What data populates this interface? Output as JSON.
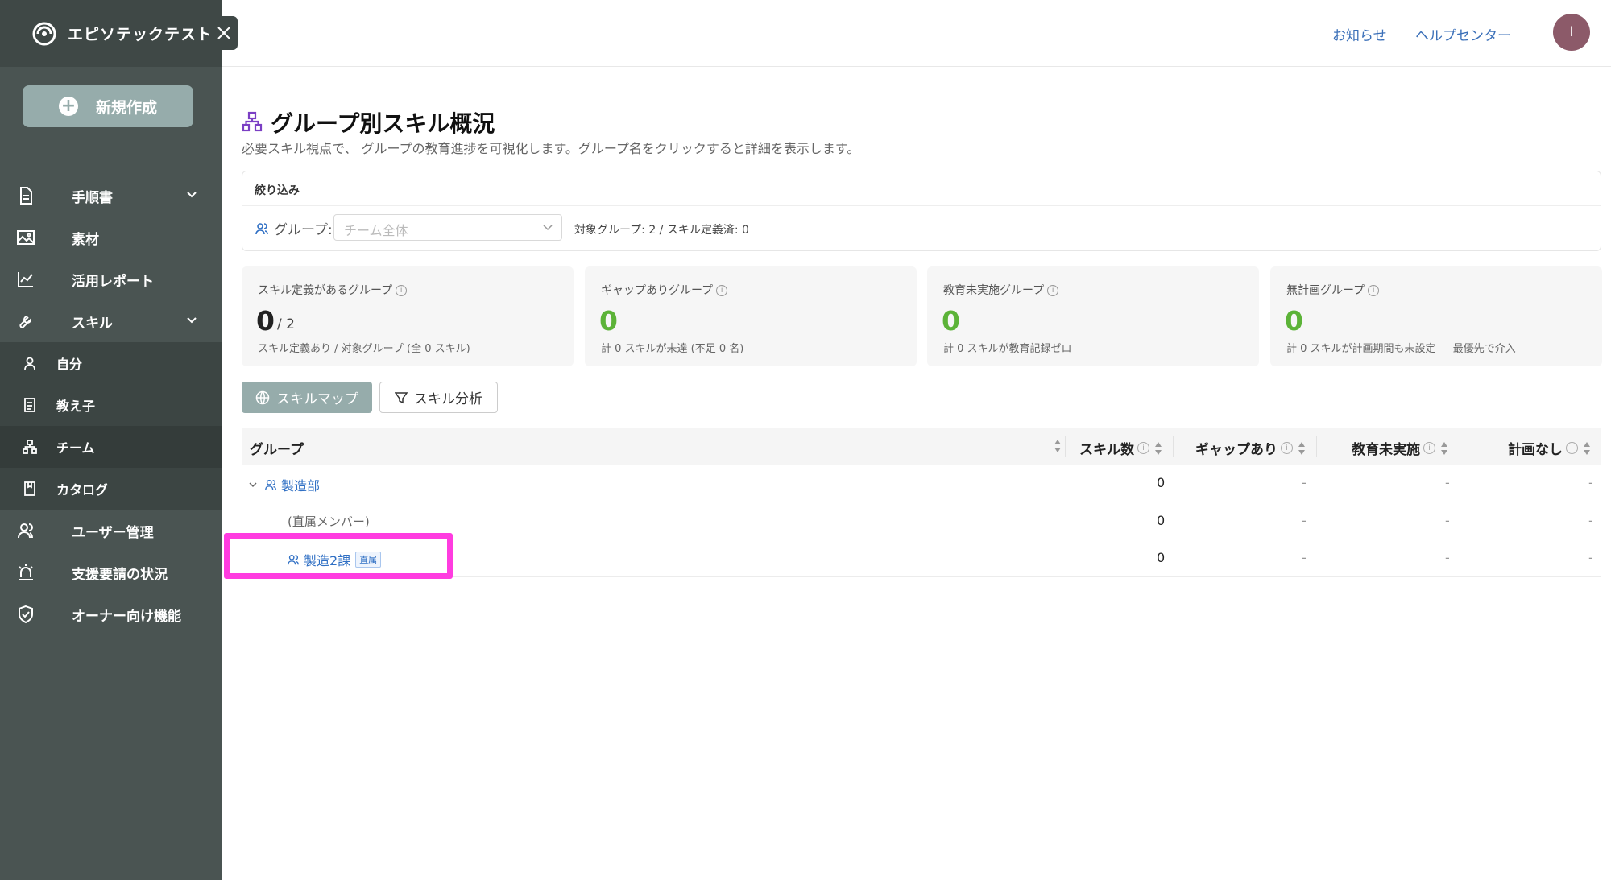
{
  "sidebar": {
    "brand": "エピソテックテスト",
    "new_button": "新規作成",
    "items": [
      {
        "label": "手順書"
      },
      {
        "label": "素材"
      },
      {
        "label": "活用レポート"
      },
      {
        "label": "スキル"
      },
      {
        "label": "自分"
      },
      {
        "label": "教え子"
      },
      {
        "label": "チーム"
      },
      {
        "label": "カタログ"
      },
      {
        "label": "ユーザー管理"
      },
      {
        "label": "支援要請の状況"
      },
      {
        "label": "オーナー向け機能"
      }
    ]
  },
  "header": {
    "notifications": "お知らせ",
    "help": "ヘルプセンター",
    "avatar_initial": "I"
  },
  "page": {
    "title": "グループ別スキル概況",
    "subtitle": "必要スキル視点で、 グループの教育進捗を可視化します。グループ名をクリックすると詳細を表示します。"
  },
  "filter": {
    "title": "絞り込み",
    "group_label": "グループ:",
    "group_placeholder": "チーム全体",
    "stats": "対象グループ: 2 / スキル定義済: 0"
  },
  "cards": [
    {
      "title": "スキル定義があるグループ",
      "value": "0",
      "denominator": "/ 2",
      "note": "スキル定義あり / 対象グループ (全 0 スキル)"
    },
    {
      "title": "ギャップありグループ",
      "value": "0",
      "note": "計 0 スキルが未達 (不足 0 名)"
    },
    {
      "title": "教育未実施グループ",
      "value": "0",
      "note": "計 0 スキルが教育記録ゼロ"
    },
    {
      "title": "無計画グループ",
      "value": "0",
      "note": "計 0 スキルが計画期間も未設定 — 最優先で介入"
    }
  ],
  "buttons": {
    "skill_map": "スキルマップ",
    "skill_analysis": "スキル分析"
  },
  "table": {
    "headers": [
      "グループ",
      "スキル数",
      "ギャップあり",
      "教育未実施",
      "計画なし"
    ],
    "rows": [
      {
        "group": "製造部",
        "skills": "0",
        "gap": "-",
        "not_trained": "-",
        "no_plan": "-"
      },
      {
        "group": "(直属メンバー)",
        "skills": "0",
        "gap": "-",
        "not_trained": "-",
        "no_plan": "-"
      },
      {
        "group": "製造2課",
        "tag": "直属",
        "skills": "0",
        "gap": "-",
        "not_trained": "-",
        "no_plan": "-"
      }
    ]
  },
  "colors": {
    "sidebar": "#4a5452",
    "accent": "#96acab",
    "link": "#2f6fc4",
    "green": "#5cb338",
    "highlight": "#ff3ce0"
  }
}
